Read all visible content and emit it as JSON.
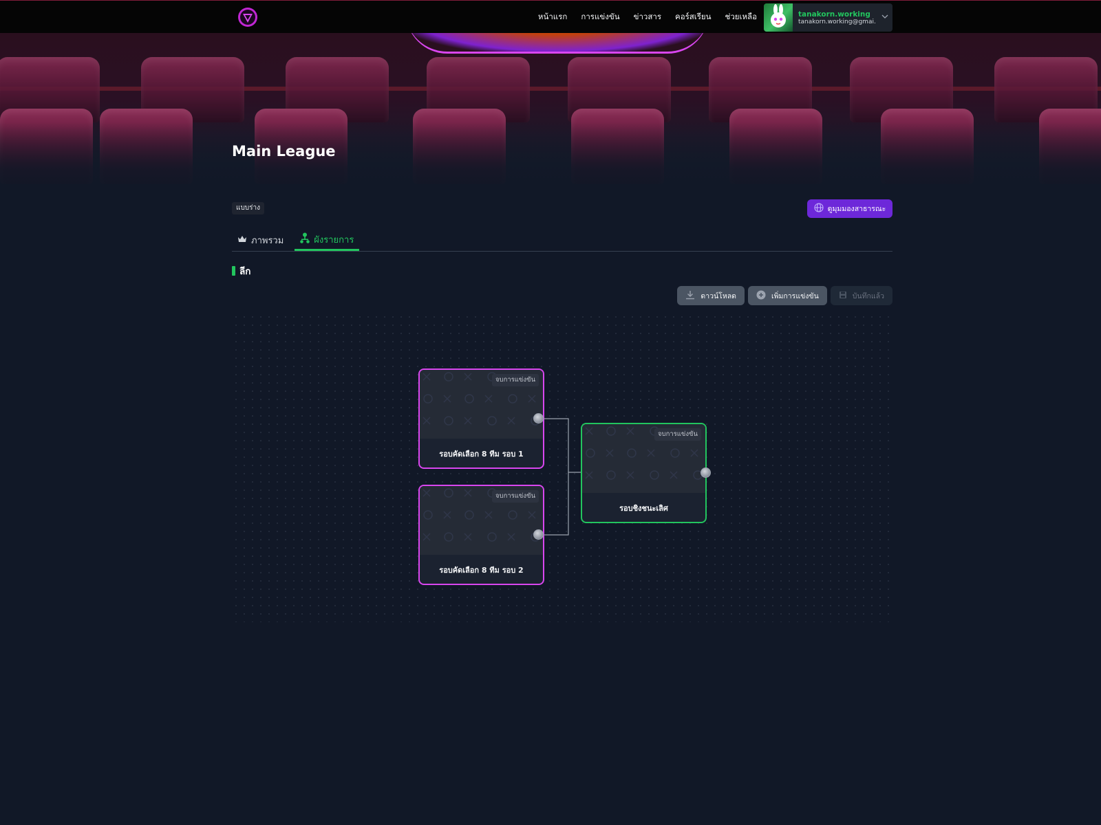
{
  "header": {
    "nav": [
      "หน้าแรก",
      "การแข่งขัน",
      "ข่าวสาร",
      "คอร์สเรียน",
      "ช่วยเหลือ"
    ],
    "user": {
      "name": "tanakorn.working",
      "email": "tanakorn.working@gmai..."
    }
  },
  "page": {
    "title": "Main League",
    "status_badge": "แบบร่าง",
    "public_button": "ดูมุมมองสาธารณะ"
  },
  "tabs": [
    {
      "label": "ภาพรวม",
      "icon": "crown-icon",
      "active": false
    },
    {
      "label": "ผังรายการ",
      "icon": "org-chart-icon",
      "active": true
    }
  ],
  "section": {
    "title": "ลีก"
  },
  "toolbar": {
    "download": "ดาวน์โหลด",
    "add_match": "เพิ่มการแข่งขัน",
    "saved": "บันทึกแล้ว"
  },
  "bracket": {
    "nodes": [
      {
        "status": "จบการแข่งขัน",
        "label": "รอบคัดเลือก 8 ทีม รอบ 1",
        "color": "#d946ef"
      },
      {
        "status": "จบการแข่งขัน",
        "label": "รอบคัดเลือก 8 ทีม รอบ 2",
        "color": "#d946ef"
      },
      {
        "status": "จบการแข่งขัน",
        "label": "รอบชิงชนะเลิศ",
        "color": "#22c55e"
      }
    ]
  },
  "colors": {
    "accent_green": "#22c55e",
    "accent_purple": "#6d28d9",
    "node_pink": "#d946ef",
    "background": "#111827"
  }
}
